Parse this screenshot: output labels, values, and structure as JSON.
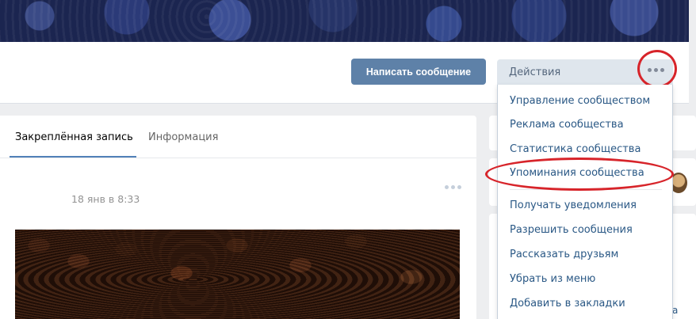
{
  "header": {
    "message_button": "Написать сообщение",
    "actions_button": "Действия",
    "more_icon": "more-horizontal-icon"
  },
  "tabs": [
    {
      "label": "Закреплённая запись",
      "active": true
    },
    {
      "label": "Информация",
      "active": false
    }
  ],
  "post": {
    "date": "18 янв в 8:33",
    "more_icon": "more-horizontal-icon",
    "image": "coffee-beans-photo"
  },
  "dropdown": {
    "items": [
      "Управление сообществом",
      "Реклама сообщества",
      "Статистика сообщества",
      "Упоминания сообщества",
      "Получать уведомления",
      "Разрешить сообщения",
      "Рассказать друзьям",
      "Убрать из меню",
      "Добавить в закладки"
    ]
  },
  "sidebar": {
    "partial_text": "а"
  },
  "colors": {
    "accent": "#5181b8",
    "button": "#5e81a8",
    "link": "#2a5885",
    "highlight": "#d7242a"
  }
}
